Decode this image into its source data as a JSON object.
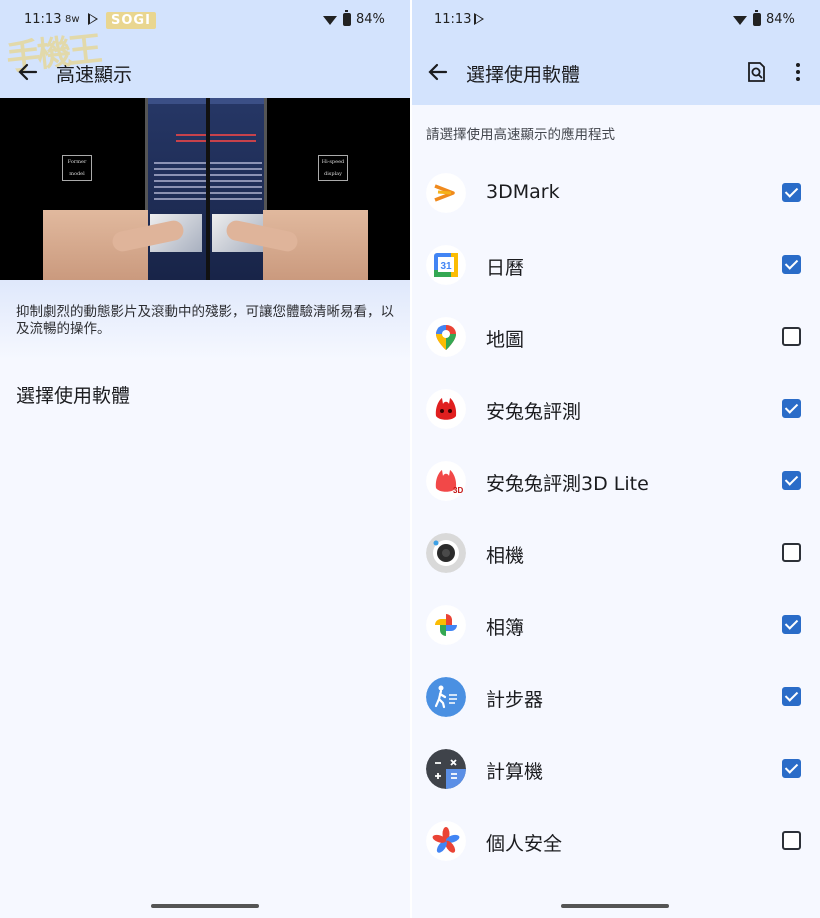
{
  "left": {
    "status": {
      "time": "11:13",
      "extra": "8w",
      "battery": "84%"
    },
    "watermark": {
      "badge": "SOGI",
      "chars": "手機王"
    },
    "appbar": {
      "title": "高速顯示"
    },
    "video": {
      "left_label": "Former model",
      "right_label": "Hi-speed display"
    },
    "description": "抑制劇烈的動態影片及滾動中的殘影，可讓您體驗清晰易看，以及流暢的操作。",
    "select_label": "選擇使用軟體"
  },
  "right": {
    "status": {
      "time": "11:13",
      "battery": "84%"
    },
    "appbar": {
      "title": "選擇使用軟體"
    },
    "subtitle": "請選擇使用高速顯示的應用程式",
    "apps": [
      {
        "name": "3DMark",
        "checked": true,
        "icon": "3dmark-icon"
      },
      {
        "name": "日曆",
        "checked": true,
        "icon": "calendar-icon"
      },
      {
        "name": "地圖",
        "checked": false,
        "icon": "maps-icon"
      },
      {
        "name": "安兔兔評測",
        "checked": true,
        "icon": "antutu-icon"
      },
      {
        "name": "安兔兔評測3D Lite",
        "checked": true,
        "icon": "antutu-3d-icon"
      },
      {
        "name": "相機",
        "checked": false,
        "icon": "camera-icon"
      },
      {
        "name": "相簿",
        "checked": true,
        "icon": "photos-icon"
      },
      {
        "name": "計步器",
        "checked": true,
        "icon": "pedometer-icon"
      },
      {
        "name": "計算機",
        "checked": true,
        "icon": "calculator-icon"
      },
      {
        "name": "個人安全",
        "checked": false,
        "icon": "personal-safety-icon"
      }
    ]
  },
  "colors": {
    "accent": "#2a6cc8",
    "header_bg": "#d3e3fd",
    "page_bg": "#f6f8ff"
  }
}
